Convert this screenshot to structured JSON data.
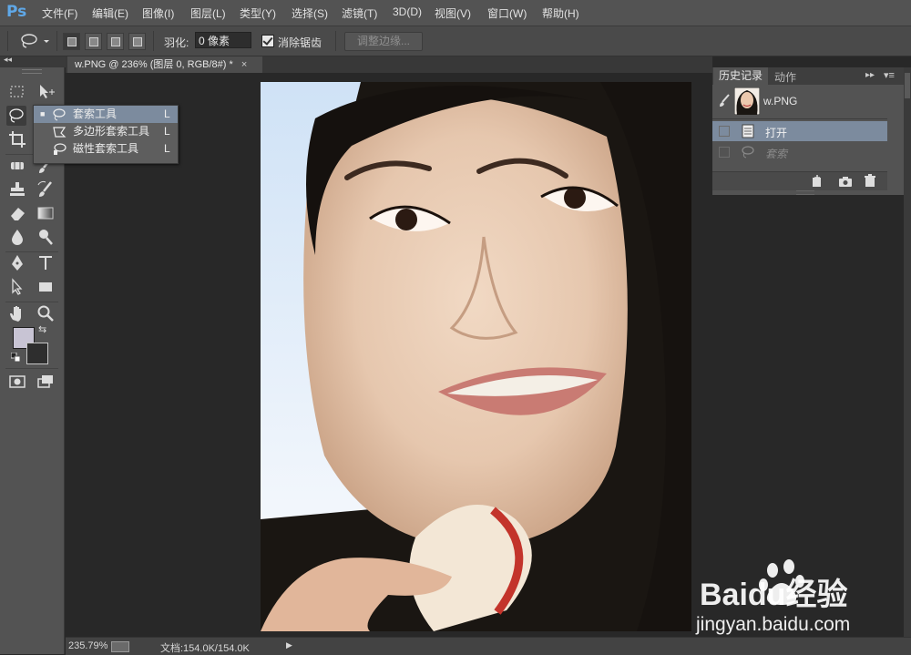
{
  "app": {
    "logo": "Ps"
  },
  "menu": [
    "文件(F)",
    "编辑(E)",
    "图像(I)",
    "图层(L)",
    "类型(Y)",
    "选择(S)",
    "滤镜(T)",
    "3D(D)",
    "视图(V)",
    "窗口(W)",
    "帮助(H)"
  ],
  "options": {
    "feather_label": "羽化:",
    "feather_value": "0 像素",
    "antialias_label": "消除锯齿",
    "refine_edge_label": "调整边缘..."
  },
  "document": {
    "tab_title": "w.PNG @ 236% (图层 0, RGB/8#) *",
    "zoom": "235.79%",
    "doc_info": "文档:154.0K/154.0K"
  },
  "flyout": {
    "items": [
      {
        "label": "套索工具",
        "shortcut": "L"
      },
      {
        "label": "多边形套索工具",
        "shortcut": "L"
      },
      {
        "label": "磁性套索工具",
        "shortcut": "L"
      }
    ]
  },
  "history": {
    "tab_label": "历史记录",
    "actions_tab_label": "动作",
    "snapshot_name": "w.PNG",
    "items": [
      "打开",
      "套索"
    ]
  },
  "watermark": {
    "brand": "Baidu经验",
    "url": "jingyan.baidu.com"
  },
  "colors": {
    "menubar": "#535353",
    "canvas_bg": "#282828",
    "selection": "#7c8b9e",
    "foreground_swatch": "#c8c4d4",
    "background_swatch": "#2e2e2e"
  },
  "icons": [
    "lasso-icon",
    "rectangular-marquee-icon",
    "move-icon",
    "crop-icon",
    "brush-icon",
    "stamp-icon",
    "eraser-icon",
    "gradient-icon",
    "blur-icon",
    "pen-icon",
    "type-icon",
    "path-selection-icon",
    "rectangle-shape-icon",
    "hand-icon",
    "zoom-icon",
    "new-snapshot-icon",
    "camera-icon",
    "trash-icon"
  ]
}
